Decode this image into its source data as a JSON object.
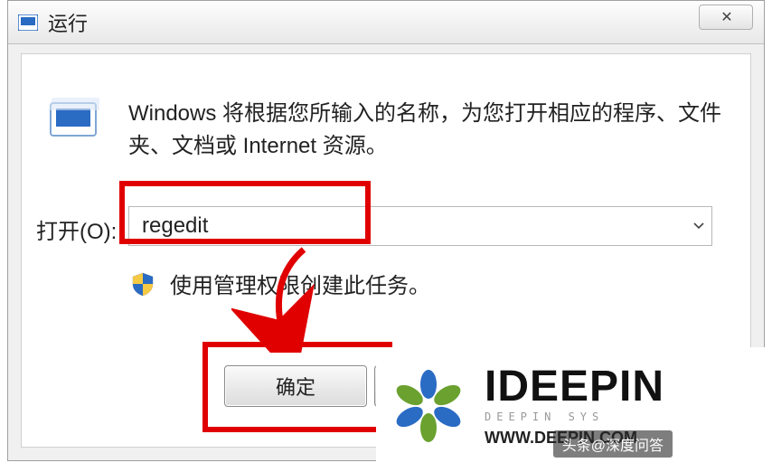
{
  "titlebar": {
    "title": "运行",
    "close_glyph": "✕"
  },
  "body": {
    "description": "Windows 将根据您所输入的名称，为您打开相应的程序、文件夹、文档或 Internet 资源。",
    "open_label": "打开(O):",
    "input_value": "regedit",
    "admin_text": "使用管理权限创建此任务。"
  },
  "buttons": {
    "ok": "确定"
  },
  "watermark": {
    "brand": "IDEEPIN",
    "tagline": "DEEPIN SYS",
    "url": "WWW.DEEPIN.COM"
  },
  "attribution": "头条@深度问答",
  "colors": {
    "highlight": "#e00000",
    "accent_blue": "#2a6bc4",
    "accent_green": "#6aa12f"
  }
}
